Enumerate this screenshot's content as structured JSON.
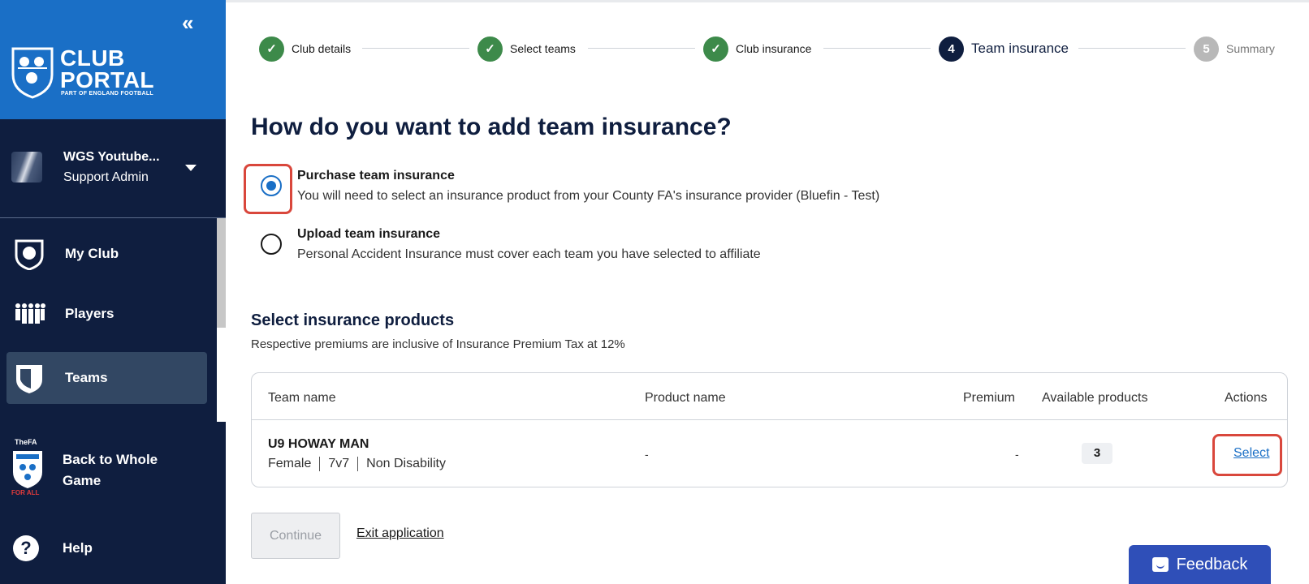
{
  "sidebar": {
    "brand_title_line1": "CLUB",
    "brand_title_line2": "PORTAL",
    "brand_subtitle": "PART OF ENGLAND FOOTBALL",
    "collapse_icon": "«",
    "user": {
      "name": "WGS Youtube...",
      "role": "Support Admin"
    },
    "items": [
      {
        "label": "My Club",
        "icon": "club-shield-icon"
      },
      {
        "label": "Players",
        "icon": "players-icon"
      },
      {
        "label": "Teams",
        "icon": "teams-shield-icon",
        "active": true
      }
    ],
    "back_label": "Back to Whole Game",
    "fa_crest_text": "TheFA",
    "fa_crest_tagline": "FOR ALL",
    "help_label": "Help",
    "help_icon": "?"
  },
  "stepper": {
    "steps": [
      {
        "label": "Club details",
        "state": "done"
      },
      {
        "label": "Select teams",
        "state": "done"
      },
      {
        "label": "Club insurance",
        "state": "done"
      },
      {
        "label": "Team insurance",
        "state": "current",
        "number": "4"
      },
      {
        "label": "Summary",
        "state": "todo",
        "number": "5"
      }
    ]
  },
  "main": {
    "title": "How do you want to add team insurance?",
    "options": [
      {
        "title": "Purchase team insurance",
        "description": "You will need to select an insurance product from your County FA's insurance provider (Bluefin - Test)",
        "selected": true
      },
      {
        "title": "Upload team insurance",
        "description": "Personal Accident Insurance must cover each team you have selected to affiliate",
        "selected": false
      }
    ],
    "section_title": "Select insurance products",
    "section_subtitle": "Respective premiums are inclusive of Insurance Premium Tax at 12%",
    "table": {
      "headers": {
        "team_name": "Team name",
        "product_name": "Product name",
        "premium": "Premium",
        "available_products": "Available products",
        "actions": "Actions"
      },
      "rows": [
        {
          "team_name": "U9 HOWAY MAN",
          "gender": "Female",
          "format": "7v7",
          "disability": "Non Disability",
          "product_name": "-",
          "premium": "-",
          "available_products": "3",
          "action": "Select"
        }
      ]
    },
    "continue_label": "Continue",
    "exit_label": "Exit application",
    "feedback_label": "Feedback"
  },
  "colors": {
    "sidebar_bg": "#0f1e3f",
    "brand_blue": "#1a6fc6",
    "step_done": "#3d8a4a",
    "highlight_red": "#d9473c",
    "feedback_blue": "#2f4fb8"
  }
}
